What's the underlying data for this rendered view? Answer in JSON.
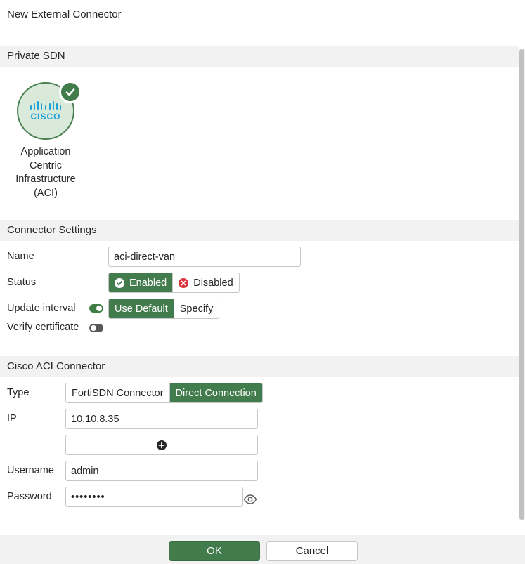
{
  "page": {
    "title": "New External Connector"
  },
  "sections": {
    "private_sdn": "Private SDN",
    "connector_settings": "Connector Settings",
    "cisco_aci": "Cisco ACI Connector"
  },
  "sdn_card": {
    "logo_text": "CISCO",
    "name_lines": [
      "Application",
      "Centric",
      "Infrastructure",
      "(ACI)"
    ]
  },
  "connector_settings": {
    "name_label": "Name",
    "name_value": "aci-direct-van",
    "status_label": "Status",
    "status_enabled": "Enabled",
    "status_disabled": "Disabled",
    "update_interval_label": "Update interval",
    "update_use_default": "Use Default",
    "update_specify": "Specify",
    "verify_certificate_label": "Verify certificate"
  },
  "cisco_aci": {
    "type_label": "Type",
    "type_fortisdn": "FortiSDN Connector",
    "type_direct": "Direct Connection",
    "ip_label": "IP",
    "ip_value": "10.10.8.35",
    "username_label": "Username",
    "username_value": "admin",
    "password_label": "Password",
    "password_value": "••••••••"
  },
  "footer": {
    "ok": "OK",
    "cancel": "Cancel"
  },
  "colors": {
    "accent": "#437c4c",
    "cisco_blue": "#1ba0d7",
    "disabled_red": "#d9363e"
  }
}
